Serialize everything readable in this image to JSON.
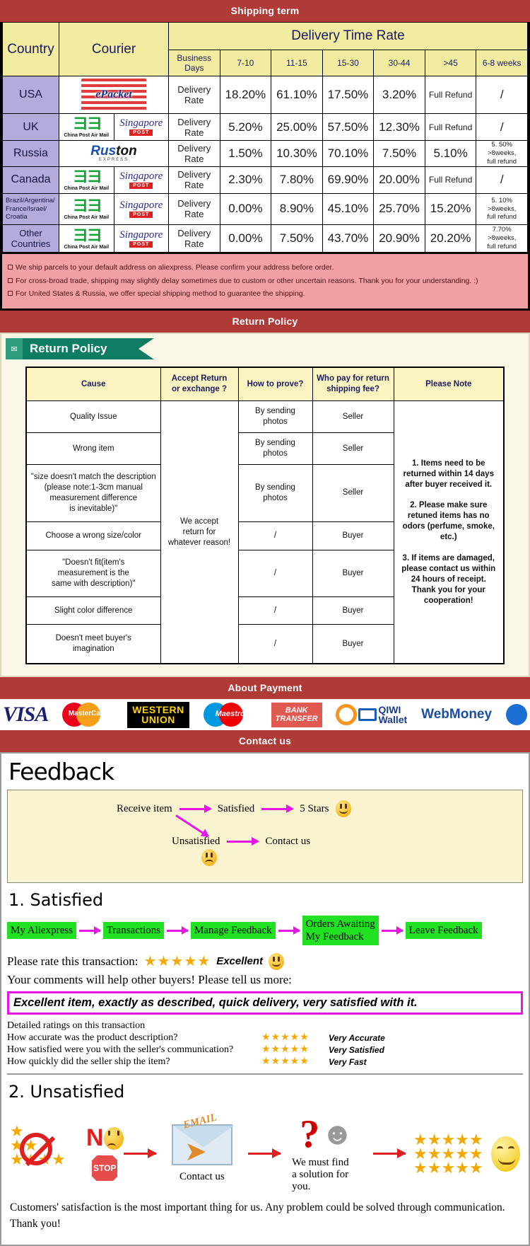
{
  "banners": {
    "shipping": "Shipping term",
    "return": "Return Policy",
    "payment": "About Payment",
    "contact": "Contact us"
  },
  "shipping_table": {
    "headers": {
      "country": "Country",
      "courier": "Courier",
      "delivery_time_rate": "Delivery Time Rate",
      "business_days": "Business Days",
      "d1": "7-10",
      "d2": "11-15",
      "d3": "15-30",
      "d4": "30-44",
      "d5": ">45",
      "d6": "6-8 weeks"
    },
    "rate_label": "Delivery Rate",
    "rows": [
      {
        "country": "USA",
        "couriers": [
          "epacket"
        ],
        "values": [
          "18.20%",
          "61.10%",
          "17.50%",
          "3.20%",
          "Full Refund",
          "/"
        ]
      },
      {
        "country": "UK",
        "couriers": [
          "china-post-air-mail",
          "singapore-post"
        ],
        "values": [
          "5.20%",
          "25.00%",
          "57.50%",
          "12.30%",
          "Full Refund",
          "/"
        ]
      },
      {
        "country": "Russia",
        "couriers": [
          "ruston-express"
        ],
        "values": [
          "1.50%",
          "10.30%",
          "70.10%",
          "7.50%",
          "5.10%",
          "5. 50%\n>8weeks,\nfull refund"
        ]
      },
      {
        "country": "Canada",
        "couriers": [
          "china-post-air-mail",
          "singapore-post"
        ],
        "values": [
          "2.30%",
          "7.80%",
          "69.90%",
          "20.00%",
          "Full Refund",
          "/"
        ]
      },
      {
        "country": "Brazil/Argentina/\nFrance/Israel/\nCroatia",
        "couriers": [
          "china-post-air-mail",
          "singapore-post"
        ],
        "values": [
          "0.00%",
          "8.90%",
          "45.10%",
          "25.70%",
          "15.20%",
          "5. 10%\n>8weeks,\nfull refund"
        ]
      },
      {
        "country": "Other Countries",
        "couriers": [
          "china-post-air-mail",
          "singapore-post"
        ],
        "values": [
          "0.00%",
          "7.50%",
          "43.70%",
          "20.90%",
          "20.20%",
          "7.70%\n>8weeks,\nfull refund"
        ]
      }
    ],
    "courier_logos": {
      "china_post": {
        "name": "China Post Air Mail"
      },
      "singapore_post": {
        "name": "Singapore",
        "tag": "POST"
      },
      "epacket": {
        "name": "ePacket"
      },
      "ruston": {
        "name1": "Rus",
        "name2": "ton",
        "sub": "EXPRESS"
      }
    },
    "notes": [
      "We ship parcels to your default address on aliexpress. Please confirm your address before order.",
      "For cross-broad trade, shipping may slightly delay sometimes due to custom or other uncertain reasons. Thank you for your understanding. :)",
      "For United States & Russia, we offer special shipping method to guarantee the shipping."
    ]
  },
  "return_policy": {
    "tab_label": "Return Policy",
    "tab_icon": "envelope-icon",
    "headers": [
      "Cause",
      "Accept Return\nor exchange ?",
      "How to prove?",
      "Who pay for return\nshipping fee?",
      "Please Note"
    ],
    "accept_text": "We accept\nreturn for\nwhatever reason!",
    "rows": [
      {
        "cause": "Quality Issue",
        "prove": "By sending\nphotos",
        "who": "Seller"
      },
      {
        "cause": "Wrong item",
        "prove": "By sending\nphotos",
        "who": "Seller"
      },
      {
        "cause": "\"size doesn't match the description\n(please note:1-3cm manual\nmeasurement difference\nis inevitable)\"",
        "prove": "By sending\nphotos",
        "who": "Seller"
      },
      {
        "cause": "Choose a wrong size/color",
        "prove": "/",
        "who": "Buyer"
      },
      {
        "cause": "\"Doesn't fit(item's\nmeasurement is the\nsame with description)\"",
        "prove": "/",
        "who": "Buyer"
      },
      {
        "cause": "Slight color difference",
        "prove": "/",
        "who": "Buyer"
      },
      {
        "cause": "Doesn't meet buyer's\nimagination",
        "prove": "/",
        "who": "Buyer"
      }
    ],
    "note": "1. Items need to be returned within 14 days after buyer received it.\n\n2. Please make sure retuned items has no odors (perfume, smoke, etc.)\n\n3. If items are damaged, please contact us within 24 hours of receipt.\nThank you for your cooperation!"
  },
  "payment": {
    "methods": [
      {
        "id": "visa",
        "label": "VISA"
      },
      {
        "id": "mastercard",
        "label": "MasterCard"
      },
      {
        "id": "western-union",
        "label1": "WESTERN",
        "label2": "UNION"
      },
      {
        "id": "maestro",
        "label": "Maestro"
      },
      {
        "id": "bank-transfer",
        "label1": "BANK",
        "label2": "TRANSFER"
      },
      {
        "id": "qiwi-wallet",
        "label1": "QIWI",
        "label2": "Wallet"
      },
      {
        "id": "webmoney",
        "label": "WebMoney"
      }
    ]
  },
  "feedback": {
    "title": "Feedback",
    "flow": {
      "receive": "Receive item",
      "satisfied": "Satisfied",
      "five_stars": "5 Stars",
      "unsatisfied": "Unsatisfied",
      "contact": "Contact us"
    },
    "satisfied": {
      "heading": "1. Satisfied",
      "steps": [
        "My Aliexpress",
        "Transactions",
        "Manage Feedback",
        "Orders Awaiting\nMy Feedback",
        "Leave Feedback"
      ],
      "rate_label": "Please rate this transaction:",
      "stars": "★★★★★",
      "rating_word": "Excellent",
      "comments_prompt": "Your comments will help other buyers! Please tell us more:",
      "comment_text": "Excellent item, exactly as described, quick delivery, very satisfied with it.",
      "detail_title": "Detailed ratings on this transaction",
      "details": [
        {
          "question": "How accurate was the product description?",
          "stars": "★★★★★",
          "value": "Very Accurate"
        },
        {
          "question": "How satisfied were you with the seller's communication?",
          "stars": "★★★★★",
          "value": "Very Satisfied"
        },
        {
          "question": "How quickly did the seller ship the item?",
          "stars": "★★★★★",
          "value": "Very Fast"
        }
      ]
    },
    "unsatisfied": {
      "heading": "2. Unsatisfied",
      "no_word": "N",
      "stop_word": "STOP",
      "email_word": "EMAIL",
      "contact_caption": "Contact us",
      "solution_caption": "We must find\na solution for\nyou.",
      "closing": "Customers' satisfaction is the most important thing for us. Any problem could be solved through communication. Thank you!"
    }
  },
  "colors": {
    "banner_red": "#b03a36",
    "header_yellow": "#f2eca1",
    "country_purple": "#b3abd9",
    "note_pink": "#f2a0a6",
    "green_step": "#22e022",
    "magenta": "#e617e6"
  }
}
